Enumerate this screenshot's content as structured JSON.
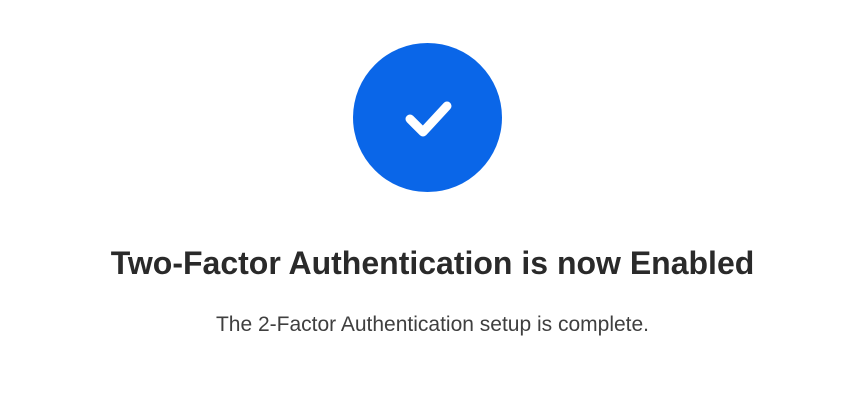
{
  "status": {
    "icon": "checkmark-icon",
    "accent_color": "#0a66e8",
    "title": "Two-Factor Authentication is now Enabled",
    "message": "The 2-Factor Authentication setup is complete."
  }
}
